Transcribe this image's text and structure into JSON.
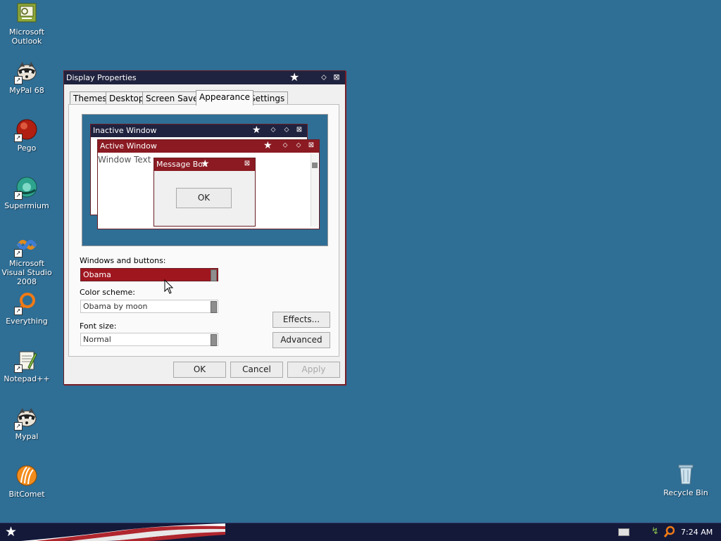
{
  "desktop": {
    "icons": [
      {
        "label": "Microsoft Outlook"
      },
      {
        "label": "MyPal 68"
      },
      {
        "label": "Pego"
      },
      {
        "label": "Supermium"
      },
      {
        "label": "Microsoft Visual Studio 2008"
      },
      {
        "label": "Everything"
      },
      {
        "label": "Notepad++"
      },
      {
        "label": "Mypal"
      },
      {
        "label": "BitComet"
      }
    ],
    "recycle_bin": {
      "label": "Recycle Bin"
    }
  },
  "dialog": {
    "title": "Display Properties",
    "tabs": [
      "Themes",
      "Desktop",
      "Screen Saver",
      "Appearance",
      "Settings"
    ],
    "active_tab": "Appearance",
    "preview": {
      "inactive_title": "Inactive Window",
      "active_title": "Active Window",
      "window_text": "Window Text",
      "message_box_title": "Message Box",
      "ok_label": "OK"
    },
    "windows_and_buttons_label": "Windows and buttons:",
    "windows_and_buttons_value": "Obama",
    "color_scheme_label": "Color scheme:",
    "color_scheme_value": "Obama by moon",
    "font_size_label": "Font size:",
    "font_size_value": "Normal",
    "effects_label": "Effects...",
    "advanced_label": "Advanced",
    "ok_label": "OK",
    "cancel_label": "Cancel",
    "apply_label": "Apply"
  },
  "taskbar": {
    "clock": "7:24 AM"
  },
  "colors": {
    "desktop": "#2f6e95",
    "title_active": "#20233f",
    "accent_red": "#8b1a22",
    "selection": "#a0161f"
  }
}
